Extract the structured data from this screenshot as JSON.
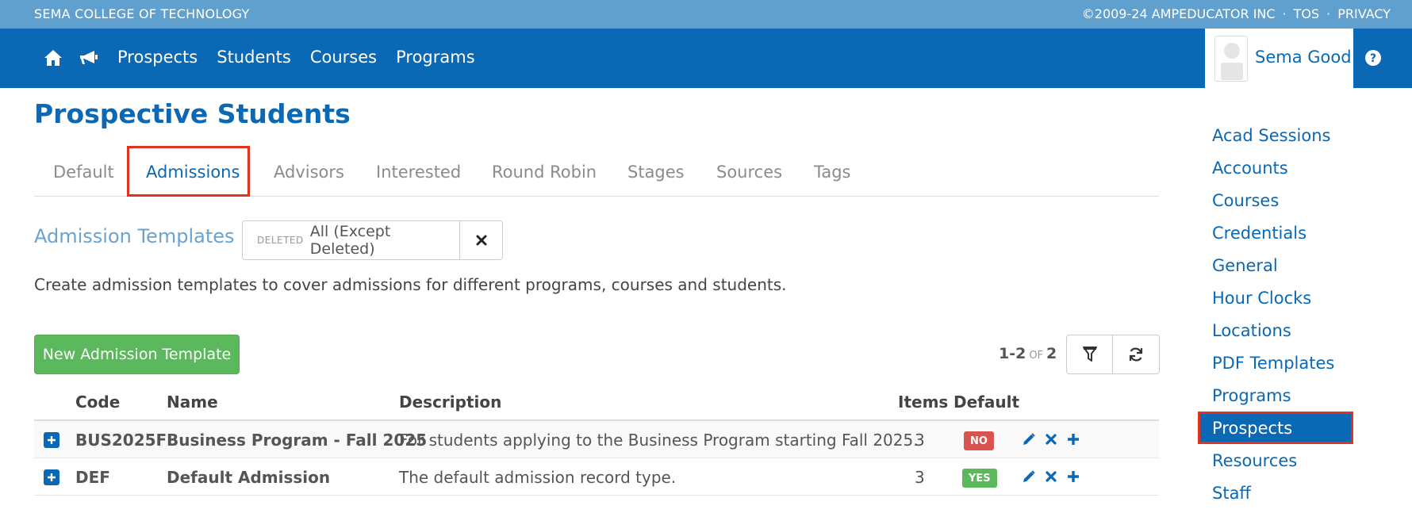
{
  "topbar": {
    "school": "SEMA COLLEGE OF TECHNOLOGY",
    "copyright": "©2009-24 AMPEDUCATOR INC",
    "sep": "·",
    "tos": "TOS",
    "privacy": "PRIVACY"
  },
  "nav": {
    "home_icon": "home-icon",
    "announce_icon": "megaphone-icon",
    "links": [
      "Prospects",
      "Students",
      "Courses",
      "Programs"
    ],
    "user_name": "Sema Good",
    "help_icon": "question-circle-icon"
  },
  "page": {
    "title": "Prospective Students"
  },
  "tabs": [
    "Default",
    "Admissions",
    "Advisors",
    "Interested",
    "Round Robin",
    "Stages",
    "Sources",
    "Tags"
  ],
  "active_tab": "Admissions",
  "section": {
    "title": "Admission Templates",
    "filter_label": "DELETED",
    "filter_value": "All (Except Deleted)",
    "description": "Create admission templates to cover admissions for different programs, courses and students.",
    "new_button": "New Admission Template"
  },
  "pager": {
    "range": "1-2",
    "of": "OF",
    "total": "2"
  },
  "table": {
    "headers": {
      "code": "Code",
      "name": "Name",
      "description": "Description",
      "items": "Items",
      "default": "Default"
    },
    "rows": [
      {
        "code": "BUS2025F",
        "name": "Business Program - Fall 2025",
        "description": "For students applying to the Business Program starting Fall 2025.",
        "items": "3",
        "default": "NO"
      },
      {
        "code": "DEF",
        "name": "Default Admission",
        "description": "The default admission record type.",
        "items": "3",
        "default": "YES"
      }
    ]
  },
  "sidebar": {
    "items": [
      "Acad Sessions",
      "Accounts",
      "Courses",
      "Credentials",
      "General",
      "Hour Clocks",
      "Locations",
      "PDF Templates",
      "Programs",
      "Prospects",
      "Resources",
      "Staff"
    ],
    "active": "Prospects"
  },
  "colors": {
    "topbar": "#5fa0cf",
    "navbar": "#0a68b5",
    "success": "#5cb85c",
    "danger": "#d9534f",
    "highlight": "#e0321f"
  }
}
